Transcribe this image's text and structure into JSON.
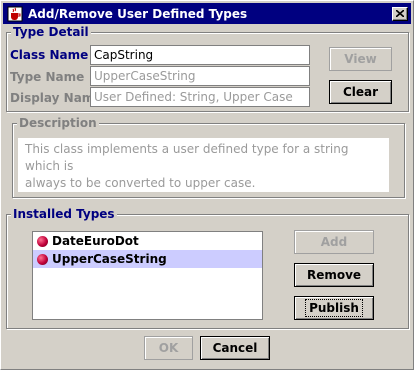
{
  "window": {
    "title": "Add/Remove User Defined Types",
    "close_icon": "close-icon",
    "app_icon": "java-cup-icon"
  },
  "type_detail": {
    "legend": "Type Detail",
    "class_name_label": "Class Name",
    "class_name_value": "CapString",
    "type_name_label": "Type Name",
    "type_name_value": "UpperCaseString",
    "display_name_label": "Display Name",
    "display_name_value": "User Defined: String,  Upper Case",
    "view_label": "View",
    "clear_label": "Clear"
  },
  "description": {
    "legend": "Description",
    "line1": "This class implements a user defined type for a string which is",
    "line2": "always to be converted to upper case."
  },
  "installed_types": {
    "legend": "Installed Types",
    "items": [
      {
        "label": "DateEuroDot",
        "selected": false
      },
      {
        "label": "UpperCaseString",
        "selected": true
      }
    ],
    "add_label": "Add",
    "remove_label": "Remove",
    "publish_label": "Publish"
  },
  "footer": {
    "ok_label": "OK",
    "cancel_label": "Cancel"
  },
  "colors": {
    "titlebar": "#000080",
    "selection": "#ccccff",
    "active_label": "#000080"
  }
}
